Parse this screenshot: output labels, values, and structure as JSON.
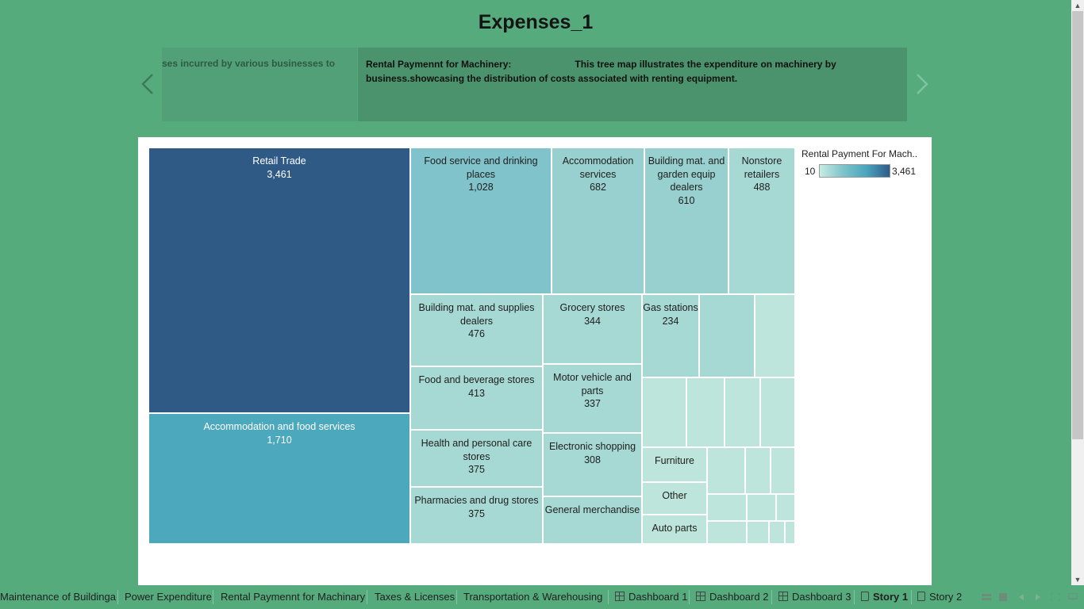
{
  "story": {
    "title": "Expenses_1",
    "prev_caption": "Expenses incurred by various businesses to",
    "caption_title": "Rental Paymennt for Machinery:",
    "caption_body": "This tree map illustrates the expenditure on machinery by business.showcasing the distribution of costs associated with renting equipment."
  },
  "legend": {
    "title": "Rental Payment For Mach..",
    "min": "10",
    "max": "3,461"
  },
  "treemap": [
    {
      "label": "Retail Trade",
      "value": "3,461"
    },
    {
      "label": "Accommodation and food services",
      "value": "1,710"
    },
    {
      "label": "Food service and drinking places",
      "value": "1,028"
    },
    {
      "label": "Accommodation services",
      "value": "682"
    },
    {
      "label": "Building mat. and garden equip dealers",
      "value": "610"
    },
    {
      "label": "Nonstore retailers",
      "value": "488"
    },
    {
      "label": "Building mat. and supplies dealers",
      "value": "476"
    },
    {
      "label": "Grocery stores",
      "value": "344"
    },
    {
      "label": "Gas stations",
      "value": "234"
    },
    {
      "label": "Food and beverage stores",
      "value": "413"
    },
    {
      "label": "Motor vehicle and parts",
      "value": "337"
    },
    {
      "label": "Health and personal care stores",
      "value": "375"
    },
    {
      "label": "Electronic shopping",
      "value": "308"
    },
    {
      "label": "Pharmacies and drug stores",
      "value": "375"
    },
    {
      "label": "General merchandise",
      "value": ""
    },
    {
      "label": "Furniture",
      "value": ""
    },
    {
      "label": "Other",
      "value": ""
    },
    {
      "label": "Auto parts",
      "value": ""
    }
  ],
  "tabs": {
    "t0": "Maintenance of Buildinga",
    "t1": "Power Expenditure",
    "t2": "Rental Paymennt for Machinary",
    "t3": "Taxes & Licenses",
    "t4": "Transportation & Warehousing",
    "t5": "Dashboard 1",
    "t6": "Dashboard 2",
    "t7": "Dashboard 3",
    "t8": "Story 1",
    "t9": "Story 2"
  },
  "colors": {
    "darkest": "#2e5a85",
    "mid": "#4ba8bd",
    "light": "#80c3ca",
    "lighter": "#97d0ce",
    "pale": "#a6d9d3",
    "palest": "#bde5db",
    "background": "#56ab7d"
  }
}
